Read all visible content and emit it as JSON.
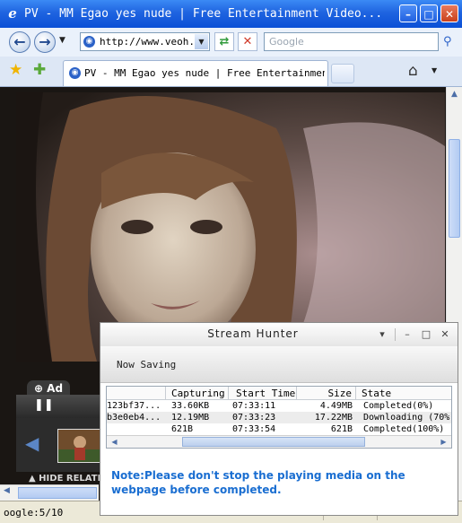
{
  "window": {
    "title": "PV - MM Egao yes nude | Free Entertainment Video...",
    "min_glyph": "–",
    "max_glyph": "□",
    "close_glyph": "✕"
  },
  "nav": {
    "back_glyph": "←",
    "forward_glyph": "→",
    "address": "http://www.veoh.com",
    "search_placeholder": "Google"
  },
  "tabs": {
    "active_label": "PV - MM Egao yes nude | Free Entertainmen..."
  },
  "player": {
    "ad_label": "Ad",
    "hide_related_label": "HIDE RELATE"
  },
  "status": {
    "text": "oogle:5/10"
  },
  "stream_hunter": {
    "title": "Stream Hunter",
    "status_label": "Now Saving",
    "columns": [
      "",
      "Capturing",
      "Start Time",
      "Size",
      "State"
    ],
    "rows": [
      {
        "name": "123bf37...",
        "capturing": "33.60KB",
        "start": "07:33:11",
        "size": "4.49MB",
        "state": "Completed(0%)"
      },
      {
        "name": "b3e0eb4...",
        "capturing": "12.19MB",
        "start": "07:33:23",
        "size": "17.22MB",
        "state": "Downloading (70%)"
      },
      {
        "name": "",
        "capturing": "621B",
        "start": "07:33:54",
        "size": "621B",
        "state": "Completed(100%)"
      }
    ],
    "note": "Note:Please don't stop the playing media on the webpage before completed."
  },
  "colors": {
    "titlebar": "#1f64e0",
    "note_text": "#1a6ed1"
  }
}
